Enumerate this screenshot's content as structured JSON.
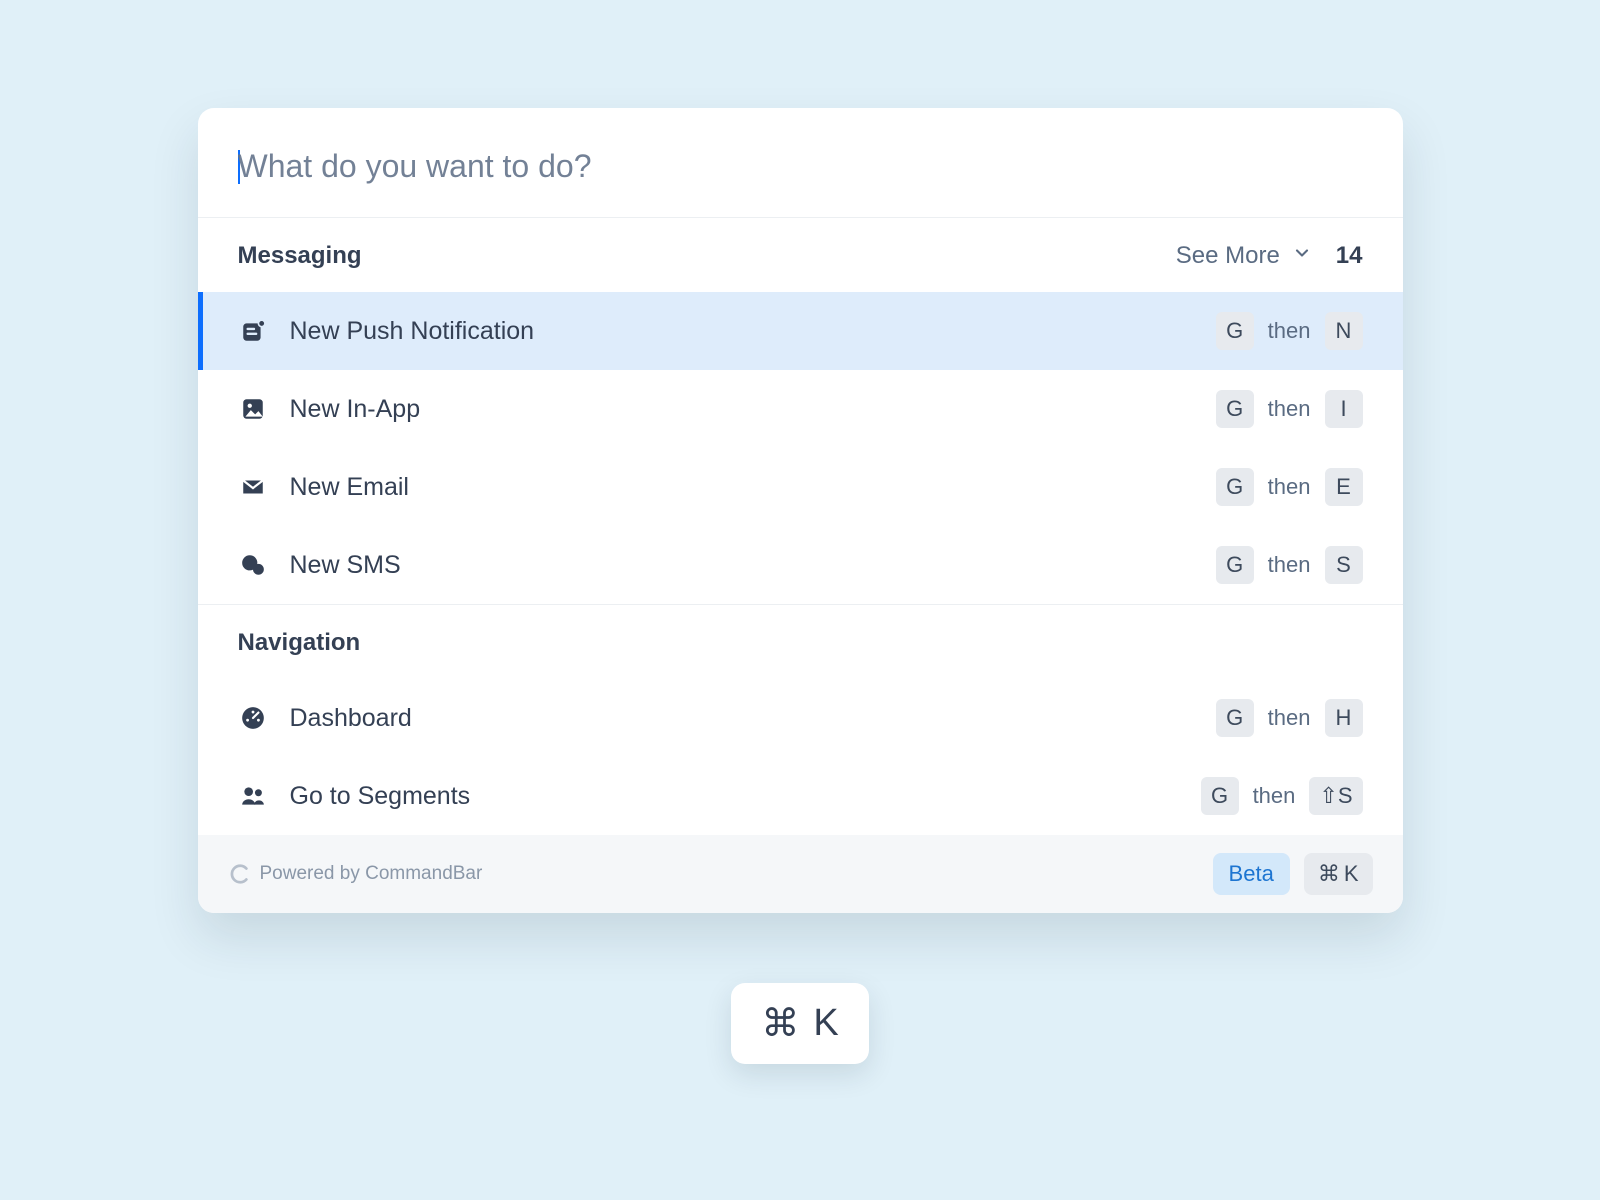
{
  "search": {
    "placeholder": "What do you want to do?",
    "value": ""
  },
  "sections": {
    "messaging": {
      "title": "Messaging",
      "see_more": "See More",
      "count": "14",
      "items": [
        {
          "label": "New Push Notification",
          "key1": "G",
          "then": "then",
          "key2": "N"
        },
        {
          "label": "New In-App",
          "key1": "G",
          "then": "then",
          "key2": "I"
        },
        {
          "label": "New Email",
          "key1": "G",
          "then": "then",
          "key2": "E"
        },
        {
          "label": "New SMS",
          "key1": "G",
          "then": "then",
          "key2": "S"
        }
      ]
    },
    "navigation": {
      "title": "Navigation",
      "items": [
        {
          "label": "Dashboard",
          "key1": "G",
          "then": "then",
          "key2": "H"
        },
        {
          "label": "Go to Segments",
          "key1": "G",
          "then": "then",
          "key2": "⇧S"
        }
      ]
    }
  },
  "footer": {
    "powered": "Powered by CommandBar",
    "beta": "Beta",
    "shortcut_glyph": "⌘",
    "shortcut_key": "K"
  },
  "floating": {
    "glyph": "⌘",
    "key": "K"
  }
}
